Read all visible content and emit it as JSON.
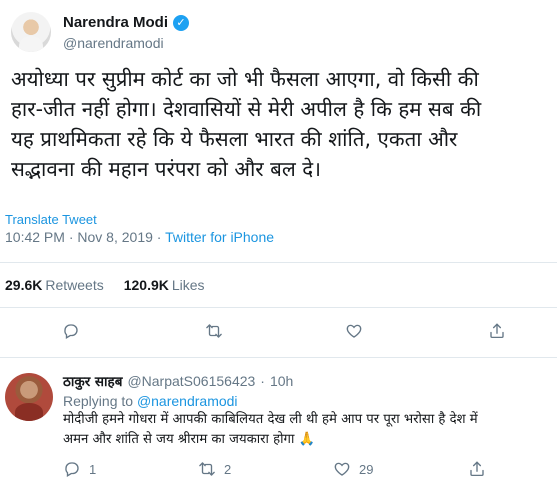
{
  "tweet": {
    "name": "Narendra Modi",
    "handle": "@narendramodi",
    "verified_glyph": "✓",
    "text_lines": [
      "अयोध्या पर सुप्रीम कोर्ट का जो भी फैसला आएगा, वो किसी की",
      "हार-जीत नहीं होगा। देशवासियों से मेरी अपील है कि हम सब की",
      "यह प्राथमिकता रहे कि ये फैसला भारत की शांति, एकता और",
      "सद्भावना की महान परंपरा को और बल दे।"
    ],
    "translate_label": "Translate Tweet",
    "time": "10:42 PM",
    "dot": "·",
    "date": "Nov 8, 2019",
    "source": "Twitter for iPhone",
    "retweets_count": "29.6K",
    "retweets_label": "Retweets",
    "likes_count": "120.9K",
    "likes_label": "Likes"
  },
  "reply": {
    "name": "ठाकुर साहब",
    "handle": "@NarpatS06156423",
    "dot": "·",
    "time": "10h",
    "replying_prefix": "Replying to",
    "replying_to": "@narendramodi",
    "text_lines": [
      "मोदीजी हमने गोधरा में आपकी काबिलियत देख ली थी हमे आप पर पूरा भरोसा है देश में",
      "अमन और शांति से जय श्रीराम का जयकारा होगा 🙏"
    ],
    "reply_count": "1",
    "retweet_count": "2",
    "like_count": "29"
  },
  "icons": {
    "reply": "reply-icon",
    "retweet": "retweet-icon",
    "like": "heart-icon",
    "share": "share-icon"
  },
  "colors": {
    "verified": "#1da1f2",
    "link": "#1b95e0",
    "muted": "#657786",
    "text": "#14171a",
    "divider": "#e1e8ed"
  }
}
